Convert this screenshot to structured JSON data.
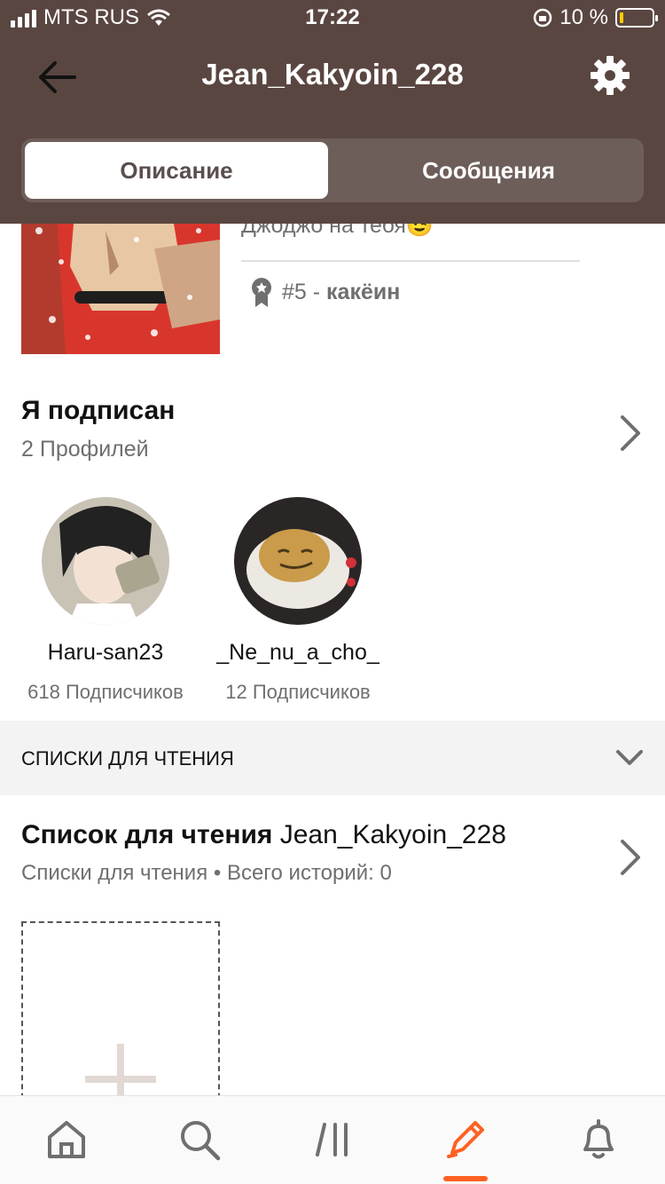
{
  "status_bar": {
    "carrier": "MTS RUS",
    "time": "17:22",
    "battery_percent": "10 %",
    "battery_level": 0.1
  },
  "header": {
    "username": "Jean_Kakyoin_228",
    "tabs": [
      {
        "label": "Описание",
        "active": true
      },
      {
        "label": "Сообщения",
        "active": false
      }
    ]
  },
  "about": {
    "description": "Джоджо на тебя😉",
    "rank_number": "#5",
    "rank_separator": " - ",
    "rank_label": "какёин"
  },
  "following": {
    "title": "Я подписан",
    "count": "2 Профилей",
    "profiles": [
      {
        "name": "Haru-san23",
        "subscribers": "618 Подписчиков"
      },
      {
        "name": "_Ne_nu_a_cho_",
        "subscribers": "12 Подписчиков"
      }
    ]
  },
  "reading_lists": {
    "section_label": "СПИСКИ ДЛЯ ЧТЕНИЯ",
    "list_title_prefix": "Список для чтения",
    "list_owner": "Jean_Kakyoin_228",
    "list_subtitle": "Списки для чтения • Всего историй: 0"
  },
  "colors": {
    "header_bg": "#5a4641",
    "accent": "#ff6122",
    "secondary_text": "#6f6f6f"
  },
  "tabbar": {
    "items": [
      "home-icon",
      "search-icon",
      "library-icon",
      "write-icon",
      "notifications-icon"
    ],
    "active": "write-icon"
  }
}
